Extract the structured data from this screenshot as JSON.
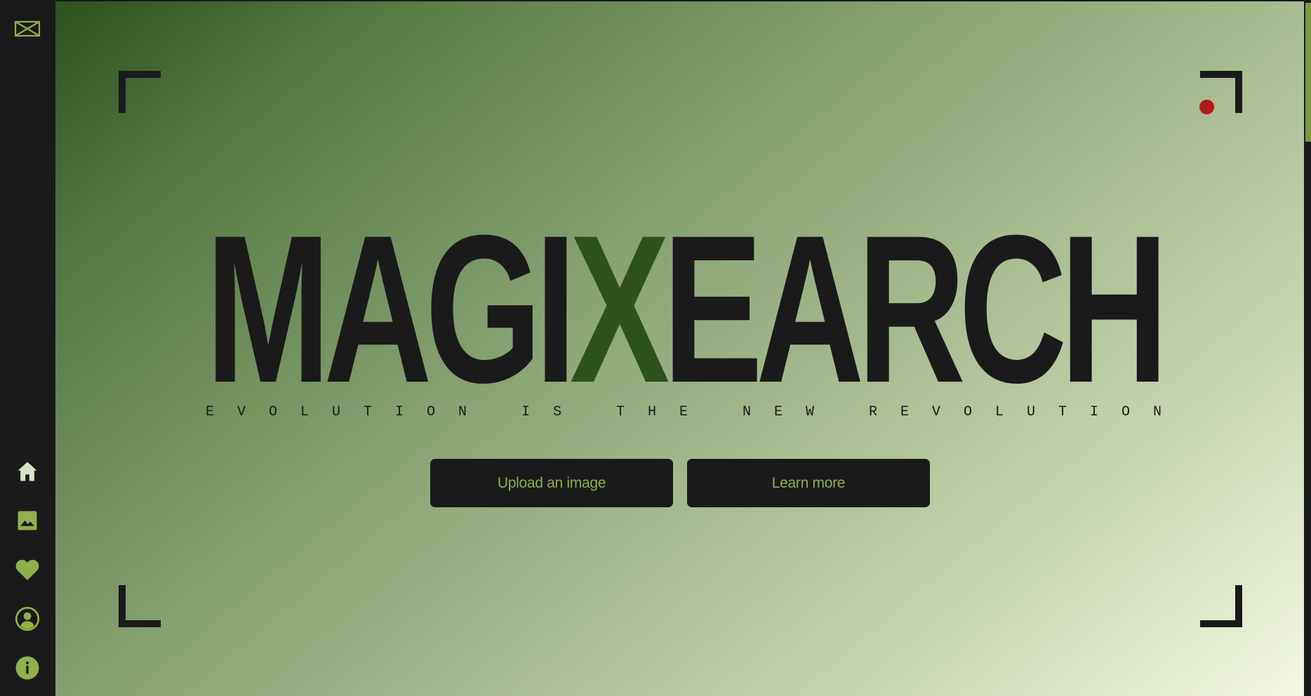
{
  "sidebar": {
    "logo_icon": "bowtie-logo-icon",
    "nav": [
      {
        "id": "home",
        "icon": "home-icon"
      },
      {
        "id": "gallery",
        "icon": "image-icon"
      },
      {
        "id": "favorites",
        "icon": "heart-icon"
      },
      {
        "id": "profile",
        "icon": "user-circle-icon"
      },
      {
        "id": "info",
        "icon": "info-icon"
      }
    ]
  },
  "hero": {
    "title_part1": "MAGI",
    "title_highlight": "X",
    "title_part2": "EARCH",
    "tagline": "EVOLUTION IS THE NEW REVOLUTION",
    "recording_indicator_color": "#b01a1a"
  },
  "actions": {
    "upload_label": "Upload an image",
    "learn_label": "Learn more"
  },
  "colors": {
    "dark": "#1a1a1a",
    "accent": "#8fb04a",
    "highlight_green": "#2f5120",
    "gradient_start": "#2f5120",
    "gradient_end": "#f3f8e2"
  }
}
